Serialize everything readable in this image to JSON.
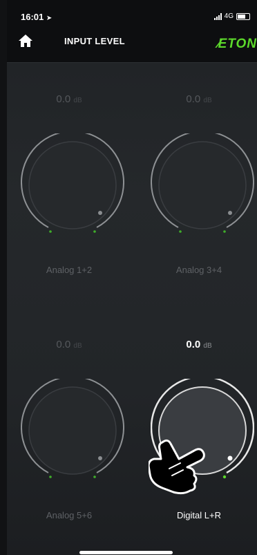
{
  "status_bar": {
    "time": "16:01",
    "network": "4G"
  },
  "header": {
    "title": "INPUT LEVEL",
    "brand": "ETON"
  },
  "channels": [
    {
      "label": "Analog 1+2",
      "value": "0.0",
      "unit": "dB",
      "active": false
    },
    {
      "label": "Analog 3+4",
      "value": "0.0",
      "unit": "dB",
      "active": false
    },
    {
      "label": "Analog 5+6",
      "value": "0.0",
      "unit": "dB",
      "active": false
    },
    {
      "label": "Digital L+R",
      "value": "0.0",
      "unit": "dB",
      "active": true
    }
  ],
  "colors": {
    "accent": "#5cd82b",
    "background": "#25282b",
    "header": "#0d0e10"
  }
}
